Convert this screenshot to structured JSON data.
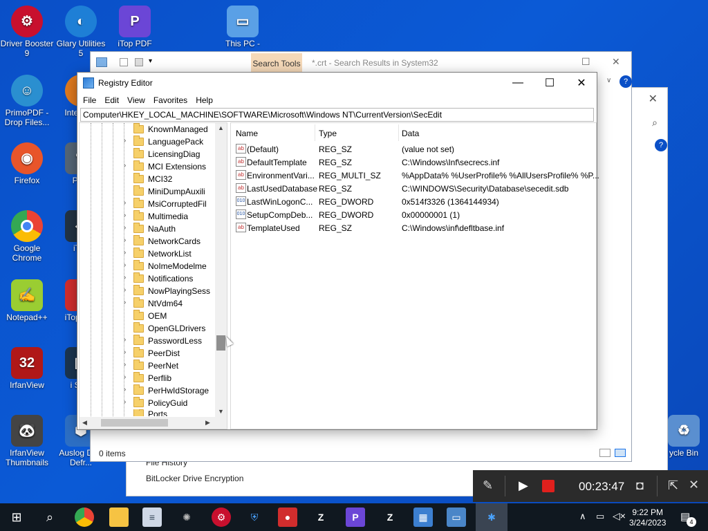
{
  "desktop_icons": [
    {
      "label": "Driver Booster 9",
      "color": "#c8102e"
    },
    {
      "label": "Glary Utilities 5",
      "color": "#1e7fd6"
    },
    {
      "label": "iTop PDF",
      "color": "#6b46d6"
    },
    {
      "label": "This PC -",
      "color": "#5aa0e6"
    },
    {
      "label": "PrimoPDF - Drop Files...",
      "color": "#2a8fd0"
    },
    {
      "label": "Inte Dow",
      "color": "#e07a1f"
    },
    {
      "label": "Firefox",
      "color": "#e8552a"
    },
    {
      "label": "Phot",
      "color": "#556677"
    },
    {
      "label": "Google Chrome",
      "color": "#34a853"
    },
    {
      "label": "iTop",
      "color": "#223344"
    },
    {
      "label": "Notepad++",
      "color": "#9acd32"
    },
    {
      "label": "iTop Rec",
      "color": "#d12d2d"
    },
    {
      "label": "IrfanView",
      "color": "#b01818"
    },
    {
      "label": "i Scre",
      "color": "#1b3550"
    },
    {
      "label": "IrfanView Thumbnails",
      "color": "#444444"
    },
    {
      "label": "Auslog Disk Defr...",
      "color": "#2d6fc4"
    },
    {
      "label": "ycle Bin",
      "color": "#5a8fd0"
    }
  ],
  "explorer": {
    "search_tools_tab": "Search Tools",
    "title": "*.crt - Search Results in System32",
    "status": "0 items"
  },
  "settings": {
    "links": [
      "File History",
      "BitLocker Drive Encryption"
    ]
  },
  "regedit": {
    "title": "Registry Editor",
    "menu": [
      "File",
      "Edit",
      "View",
      "Favorites",
      "Help"
    ],
    "address": "Computer\\HKEY_LOCAL_MACHINE\\SOFTWARE\\Microsoft\\Windows NT\\CurrentVersion\\SecEdit",
    "tree": [
      {
        "label": "KnownManaged",
        "expandable": false
      },
      {
        "label": "LanguagePack",
        "expandable": true
      },
      {
        "label": "LicensingDiag",
        "expandable": false
      },
      {
        "label": "MCI Extensions",
        "expandable": true
      },
      {
        "label": "MCI32",
        "expandable": false
      },
      {
        "label": "MiniDumpAuxili",
        "expandable": false
      },
      {
        "label": "MsiCorruptedFil",
        "expandable": true
      },
      {
        "label": "Multimedia",
        "expandable": true
      },
      {
        "label": "NaAuth",
        "expandable": true
      },
      {
        "label": "NetworkCards",
        "expandable": true
      },
      {
        "label": "NetworkList",
        "expandable": true
      },
      {
        "label": "NoImeModelme",
        "expandable": true
      },
      {
        "label": "Notifications",
        "expandable": true
      },
      {
        "label": "NowPlayingSess",
        "expandable": true
      },
      {
        "label": "NtVdm64",
        "expandable": true
      },
      {
        "label": "OEM",
        "expandable": false
      },
      {
        "label": "OpenGLDrivers",
        "expandable": false
      },
      {
        "label": "PasswordLess",
        "expandable": true
      },
      {
        "label": "PeerDist",
        "expandable": true
      },
      {
        "label": "PeerNet",
        "expandable": true
      },
      {
        "label": "Perflib",
        "expandable": true
      },
      {
        "label": "PerHwIdStorage",
        "expandable": true
      },
      {
        "label": "PolicyGuid",
        "expandable": true
      },
      {
        "label": "Ports",
        "expandable": false
      }
    ],
    "columns": [
      "Name",
      "Type",
      "Data"
    ],
    "values": [
      {
        "name": "(Default)",
        "type": "REG_SZ",
        "data": "(value not set)",
        "icon": "ab"
      },
      {
        "name": "DefaultTemplate",
        "type": "REG_SZ",
        "data": "C:\\Windows\\Inf\\secrecs.inf",
        "icon": "ab"
      },
      {
        "name": "EnvironmentVari...",
        "type": "REG_MULTI_SZ",
        "data": "%AppData% %UserProfile% %AllUsersProfile% %P...",
        "icon": "ab"
      },
      {
        "name": "LastUsedDatabase",
        "type": "REG_SZ",
        "data": "C:\\WINDOWS\\Security\\Database\\secedit.sdb",
        "icon": "ab"
      },
      {
        "name": "LastWinLogonC...",
        "type": "REG_DWORD",
        "data": "0x514f3326 (1364144934)",
        "icon": "010"
      },
      {
        "name": "SetupCompDeb...",
        "type": "REG_DWORD",
        "data": "0x00000001 (1)",
        "icon": "010"
      },
      {
        "name": "TemplateUsed",
        "type": "REG_SZ",
        "data": "C:\\Windows\\inf\\defltbase.inf",
        "icon": "ab"
      }
    ]
  },
  "recorder": {
    "elapsed": "00:23:47"
  },
  "taskbar": {
    "time": "9:22 PM",
    "date": "3/24/2023",
    "notification_count": "4"
  }
}
